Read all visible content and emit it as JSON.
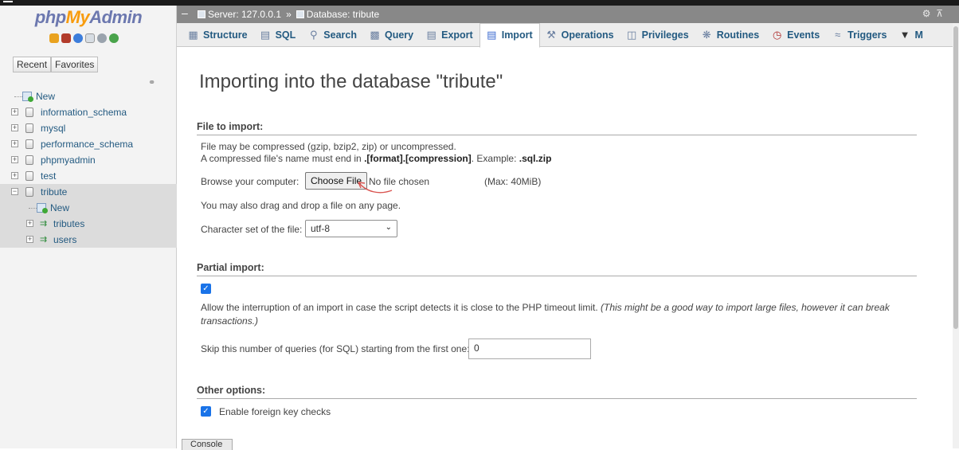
{
  "nav": {
    "logo": {
      "php": "php",
      "my": "My",
      "admin": "Admin"
    },
    "icons": [
      "home-icon",
      "sql-icon",
      "help-icon",
      "docs-icon",
      "settings-icon",
      "reload-icon"
    ],
    "tabs": [
      "Recent",
      "Favorites"
    ],
    "tree": [
      {
        "label": "New",
        "type": "new",
        "level": 0
      },
      {
        "label": "information_schema",
        "type": "db",
        "level": 0
      },
      {
        "label": "mysql",
        "type": "db",
        "level": 0
      },
      {
        "label": "performance_schema",
        "type": "db",
        "level": 0
      },
      {
        "label": "phpmyadmin",
        "type": "db",
        "level": 0
      },
      {
        "label": "test",
        "type": "db",
        "level": 0
      },
      {
        "label": "tribute",
        "type": "db",
        "level": 0,
        "expanded": true,
        "selected": true
      },
      {
        "label": "New",
        "type": "new",
        "level": 1
      },
      {
        "label": "tributes",
        "type": "table",
        "level": 1
      },
      {
        "label": "users",
        "type": "table",
        "level": 1
      }
    ]
  },
  "breadcrumb": {
    "server": "Server: 127.0.0.1",
    "database": "Database: tribute"
  },
  "tabs": [
    {
      "label": "Structure",
      "icon": "structure-icon"
    },
    {
      "label": "SQL",
      "icon": "sql-icon"
    },
    {
      "label": "Search",
      "icon": "search-icon"
    },
    {
      "label": "Query",
      "icon": "query-icon"
    },
    {
      "label": "Export",
      "icon": "export-icon"
    },
    {
      "label": "Import",
      "icon": "import-icon",
      "active": true
    },
    {
      "label": "Operations",
      "icon": "wrench-icon"
    },
    {
      "label": "Privileges",
      "icon": "privileges-icon"
    },
    {
      "label": "Routines",
      "icon": "routines-icon"
    },
    {
      "label": "Events",
      "icon": "clock-icon"
    },
    {
      "label": "Triggers",
      "icon": "triggers-icon"
    },
    {
      "label": "M",
      "icon": "more-arrow-icon"
    }
  ],
  "page": {
    "title": "Importing into the database \"tribute\"",
    "file_section": {
      "legend": "File to import:",
      "line1": "File may be compressed (gzip, bzip2, zip) or uncompressed.",
      "line2_pre": "A compressed file's name must end in ",
      "line2_bold": ".[format].[compression]",
      "line2_mid": ". Example: ",
      "line2_example": ".sql.zip",
      "browse_label": "Browse your computer:",
      "choose_file": "Choose File",
      "no_file": "No file chosen",
      "max": "(Max: 40MiB)",
      "drag_note": "You may also drag and drop a file on any page.",
      "charset_label": "Character set of the file:",
      "charset_value": "utf-8"
    },
    "partial_section": {
      "legend": "Partial import:",
      "allow_checked": true,
      "allow_text": "Allow the interruption of an import in case the script detects it is close to the PHP timeout limit.",
      "allow_note": "(This might be a good way to import large files, however it can break transactions.)",
      "allow_note_line1": "(This might be a good way to import large files, however it can break",
      "allow_note_line2": "transactions.)",
      "skip_label": "Skip this number of queries (for SQL) starting from the first one:",
      "skip_value": "0"
    },
    "other_section": {
      "legend": "Other options:",
      "fk_checked": true,
      "fk_label": "Enable foreign key checks"
    }
  },
  "console": {
    "label": "Console"
  },
  "colors": {
    "accent": "#235a81",
    "checkbox": "#1a73e8",
    "annotation": "#d9534f"
  }
}
